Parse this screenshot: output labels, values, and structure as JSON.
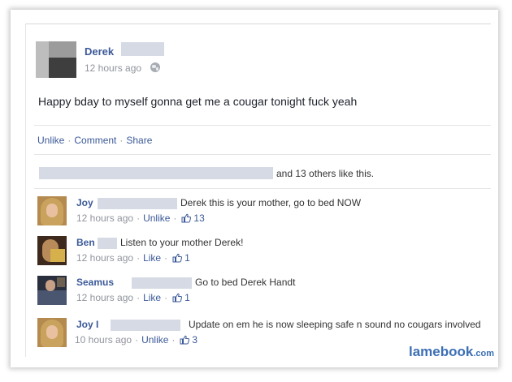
{
  "post": {
    "author": "Derek",
    "time": "12 hours ago",
    "privacy_icon": "globe-icon",
    "status": "Happy bday to myself gonna get me a cougar tonight fuck yeah"
  },
  "actions": {
    "unlike": "Unlike",
    "comment": "Comment",
    "share": "Share",
    "separator": "·"
  },
  "likes": {
    "text": "and 13 others like this."
  },
  "comments": [
    {
      "name": "Joy",
      "text": "Derek this is your mother, go to bed NOW",
      "time": "12 hours ago",
      "action": "Unlike",
      "likes": "13"
    },
    {
      "name": "Ben",
      "text": "Listen to your mother Derek!",
      "time": "12 hours ago",
      "action": "Like",
      "likes": "1"
    },
    {
      "name": "Seamus",
      "text": "Go to bed Derek Handt",
      "time": "12 hours ago",
      "action": "Like",
      "likes": "1"
    },
    {
      "name": "Joy I",
      "text": "Update on em he is now sleeping safe n sound no cougars involved",
      "time": "10 hours ago",
      "action": "Unlike",
      "likes": "3"
    }
  ],
  "watermark": {
    "main": "lamebook",
    "suffix": ".com"
  },
  "colors": {
    "link": "#3b5998",
    "meta": "#90949c",
    "text": "#1d2129",
    "watermark": "#3c6fb4"
  }
}
